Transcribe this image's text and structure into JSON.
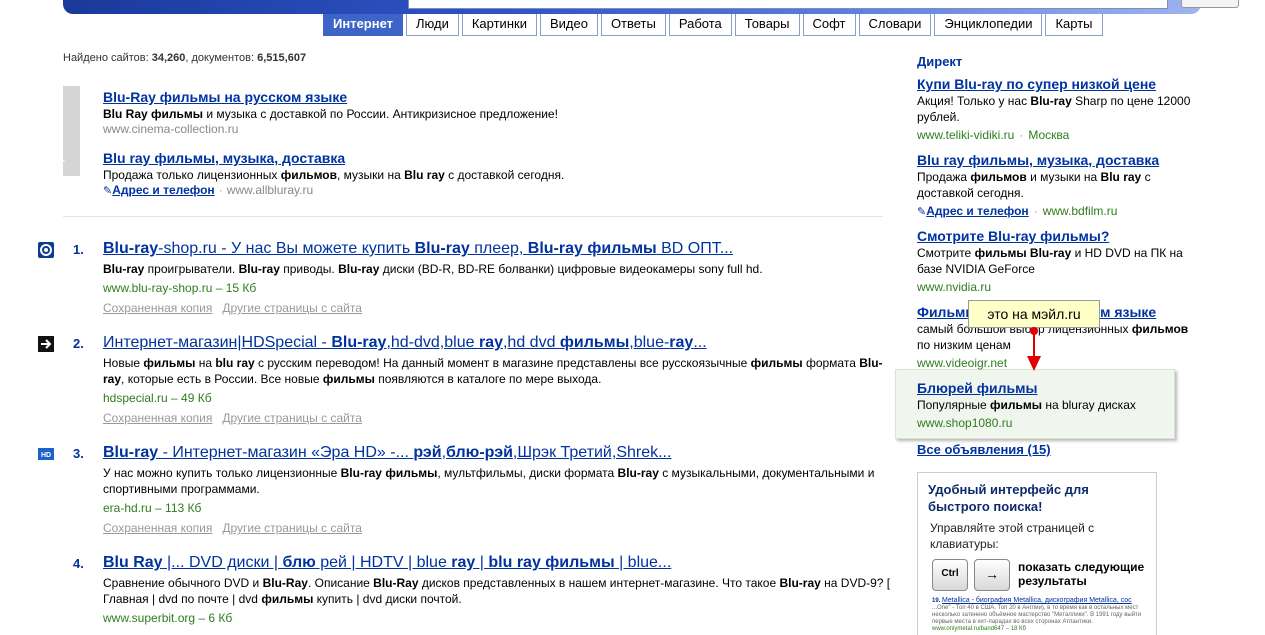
{
  "tabs": [
    {
      "label": "Интернет",
      "active": true
    },
    {
      "label": "Люди"
    },
    {
      "label": "Картинки"
    },
    {
      "label": "Видео"
    },
    {
      "label": "Ответы"
    },
    {
      "label": "Работа"
    },
    {
      "label": "Товары"
    },
    {
      "label": "Софт"
    },
    {
      "label": "Словари"
    },
    {
      "label": "Энциклопедии"
    },
    {
      "label": "Карты"
    }
  ],
  "found": {
    "prefix": "Найдено сайтов: ",
    "sites": "34,260",
    "mid": ", документов: ",
    "docs": "6,515,607"
  },
  "ads": {
    "label": "реклама",
    "items": [
      {
        "title": "Blu-Ray фильмы на русском языке",
        "desc": [
          "<b>Blu Ray фильмы</b> и музыка с доставкой по России. Антикризисное предложение!"
        ],
        "url": "www.cinema-collection.ru"
      },
      {
        "title": "Blu ray фильмы, музыка, доставка",
        "desc": [
          "Продажа только лицензионных <b>фильмов</b>, музыки на <b>Blu ray</b> с доставкой сегодня."
        ],
        "address": "Адрес и телефон",
        "url": "www.allbluray.ru"
      }
    ]
  },
  "results": [
    {
      "num": "1.",
      "icon": "blue-circle-logo-icon",
      "title": "<b>Blu-ray</b>-shop.ru - У нас Вы можете купить <b>Blu-ray</b> плеер, <b>Blu-ray фильмы</b> BD ОПТ...",
      "snippet": "<b>Blu-ray</b> проигрыватели. <b>Blu-ray</b> приводы. <b>Blu-ray</b> диски (BD-R, BD-RE болванки) цифровые видеокамеры sony full hd.",
      "url": "www.blu-ray-shop.ru – 15 Кб",
      "links": [
        "Сохраненная копия",
        "Другие страницы с сайта"
      ]
    },
    {
      "num": "2.",
      "icon": "arrow-right-icon",
      "title": "Интернет-магазин|HDSpecial - <b>Blu-ray</b>,hd-dvd,blue <b>ray</b>,hd dvd <b>фильмы</b>,blue-<b>ray</b>...",
      "snippet": "Новые <b>фильмы</b> на <b>blu ray</b> с русским переводом! На данный момент в магазине представлены все русскоязычные <b>фильмы</b> формата <b>Blu-ray</b>, которые есть в России. Все новые <b>фильмы</b> появляются в каталоге по мере выхода.",
      "url": "hdspecial.ru – 49 Кб",
      "links": [
        "Сохраненная копия",
        "Другие страницы с сайта"
      ]
    },
    {
      "num": "3.",
      "icon": "hd-logo-icon",
      "title": "<b>Blu-ray</b> - Интернет-магазин «Эра HD» -... <b>рэй</b>,<b>блю-рэй</b>,Шрэк Третий,Shrek...",
      "snippet": "У нас можно купить только лицензионные <b>Blu-ray фильмы</b>, мультфильмы, диски формата <b>Blu-ray</b> с музыкальными, документальными и спортивными программами.",
      "url": "era-hd.ru – 113 Кб",
      "links": [
        "Сохраненная копия",
        "Другие страницы с сайта"
      ]
    },
    {
      "num": "4.",
      "icon": "",
      "title": "<b>Blu Ray</b> |... DVD диски | <b>блю</b> рей | HDTV | blue <b>ray</b> | <b>blu ray фильмы</b> | blue...",
      "snippet": "Сравнение обычного DVD и <b>Blu-Ray</b>. Описание <b>Blu-Ray</b> дисков представленных в нашем интернет-магазине. Что такое <b>Blu-ray</b> на DVD-9? [ Главная | dvd по почте | dvd <b>фильмы</b> купить | dvd диски почтой.",
      "url": "www.superbit.org – 6 Кб",
      "links": []
    }
  ],
  "direct": {
    "heading": "Директ",
    "items": [
      {
        "title": "Купи Blu-ray по супер низкой цене",
        "desc": "Акция! Только у нас <b>Blu-ray</b> Sharp по цене 12000 рублей.",
        "url": "www.teliki-vidiki.ru",
        "city": "Москва"
      },
      {
        "title": "Blu ray фильмы, музыка, доставка",
        "desc": "Продажа <b>фильмов</b> и музыки на <b>Blu ray</b> с доставкой сегодня.",
        "address": "Адрес и телефон",
        "url": "www.bdfilm.ru"
      },
      {
        "title": "Смотрите Blu-ray фильмы?",
        "desc": "Смотрите <b>фильмы Blu-ray</b> и HD DVD на ПК на базе NVIDIA GeForce",
        "url": "www.nvidia.ru"
      },
      {
        "title": "Фильмы Blu-ray на русском языке",
        "desc": "самый большой выбор лицензионных <b>фильмов</b> по низким ценам",
        "url": "www.videoigr.net"
      },
      {
        "title": "Блюрей фильмы",
        "desc": "Популярные <b>фильмы</b> на bluray дисках",
        "url": "www.shop1080.ru",
        "highlighted": true
      }
    ],
    "all_ads": "Все объявления (15)"
  },
  "tooltip": "это на мэйл.ru",
  "promo": {
    "heading": "Удобный интерфейс для быстрого поиска!",
    "text": "Управляйте этой страницей с клавиатуры:",
    "key1": "Ctrl",
    "key2": "→",
    "shortcut": "показать следующие результаты",
    "mini_num": "19.",
    "mini_title": "Metallica - биография Metallica, дискография Metallica, сос",
    "mini_snippet": "...One\" - Топ 40 в США, Топ 20 в Англии), в то время как в остальных мест несколько затенено объёмное мастерство \"Металлики\". В 1991 году выйти первые места в хит-парадах во всех сторонах Атлантики.",
    "mini_url": "www.onlymetal.ru/band647 – 18 Кб"
  },
  "colors": {
    "link": "#0033a0",
    "url": "#2e7d1e",
    "tab_active": "#3f64c8",
    "tooltip_bg": "#ffffc8",
    "highlight_bg": "#f0f6ee"
  }
}
